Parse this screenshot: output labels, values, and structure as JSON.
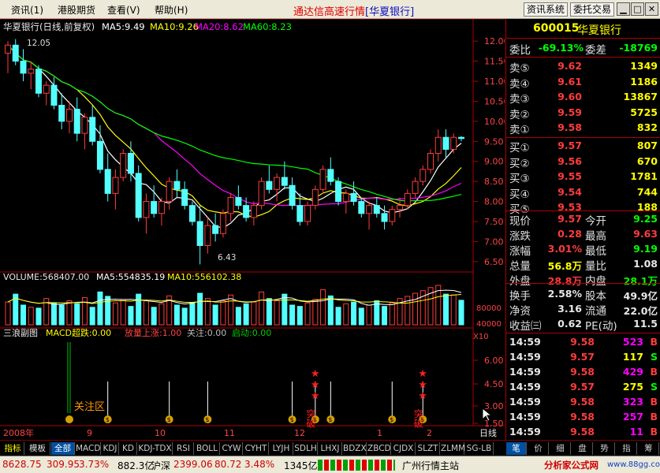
{
  "menu": {
    "items": [
      "资讯(1)",
      "港股期货",
      "查看(V)",
      "帮助(H)"
    ],
    "title": "通达信高速行情",
    "title_stock": "[华夏银行]",
    "btn1": "资讯系统",
    "btn2": "委托交易",
    "win_min": "▁",
    "win_max": "□",
    "win_close": "✕"
  },
  "chart_header": {
    "title": "华夏银行(日线,前复权)",
    "ma5": "MA5:9.49",
    "ma10": "MA10:9.26",
    "ma20": "MA20:8.62",
    "ma60": "MA60:8.23"
  },
  "vol_header": {
    "volume": "VOLUME:568407.00",
    "ma5": "MA5:554835.19",
    "ma10": "MA10:556102.38"
  },
  "ind_header": {
    "name": "三浪副图",
    "v1": "MACD超跌:0.00",
    "v2": "放量上涨:1.00",
    "v3": "关注:0.00",
    "v4": "启动:0.00"
  },
  "annotations": {
    "high": "12.05",
    "low": "6.43",
    "attn_zone": "关注区",
    "buy": "突破"
  },
  "x_axis": {
    "year": "2008年",
    "months": [
      "9",
      "10",
      "11",
      "12",
      "1",
      "2"
    ],
    "period": "日线"
  },
  "price_axis": [
    "12.00",
    "11.50",
    "11.00",
    "10.50",
    "10.00",
    "9.50",
    "9.00",
    "8.50",
    "8.00",
    "7.50",
    "7.00",
    "6.50"
  ],
  "vol_axis": [
    "80000",
    "40000",
    "X10"
  ],
  "ind_axis": [
    "6.00",
    "4.50",
    "3.00",
    "1.50"
  ],
  "chart_data": {
    "type": "candlestick",
    "ylim": [
      6.3,
      12.2
    ],
    "candles": [
      [
        11.7,
        12.0,
        11.2,
        11.9
      ],
      [
        11.9,
        12.05,
        11.4,
        11.5
      ],
      [
        11.5,
        11.8,
        11.0,
        11.2
      ],
      [
        11.2,
        11.5,
        10.8,
        11.3
      ],
      [
        11.3,
        11.4,
        10.6,
        10.7
      ],
      [
        10.7,
        11.0,
        10.4,
        10.9
      ],
      [
        10.9,
        11.1,
        10.3,
        10.4
      ],
      [
        10.4,
        10.7,
        9.8,
        10.0
      ],
      [
        10.0,
        10.5,
        9.7,
        10.3
      ],
      [
        10.3,
        10.6,
        9.5,
        9.7
      ],
      [
        9.7,
        10.2,
        9.3,
        10.1
      ],
      [
        10.1,
        10.4,
        9.4,
        9.5
      ],
      [
        9.5,
        9.9,
        8.7,
        8.8
      ],
      [
        8.8,
        9.2,
        8.0,
        8.2
      ],
      [
        8.2,
        8.8,
        7.8,
        8.6
      ],
      [
        8.6,
        9.3,
        8.5,
        9.2
      ],
      [
        9.2,
        9.5,
        8.5,
        8.7
      ],
      [
        8.7,
        8.9,
        7.5,
        7.6
      ],
      [
        7.6,
        8.2,
        7.2,
        8.0
      ],
      [
        8.0,
        8.4,
        7.6,
        7.7
      ],
      [
        7.7,
        8.1,
        7.4,
        8.0
      ],
      [
        8.0,
        8.6,
        7.8,
        8.5
      ],
      [
        8.5,
        8.8,
        8.1,
        8.3
      ],
      [
        8.3,
        8.5,
        7.8,
        7.9
      ],
      [
        7.9,
        8.0,
        7.4,
        7.5
      ],
      [
        7.5,
        7.9,
        6.43,
        6.9
      ],
      [
        6.9,
        7.6,
        6.7,
        7.4
      ],
      [
        7.4,
        7.7,
        7.0,
        7.2
      ],
      [
        7.2,
        7.8,
        7.1,
        7.7
      ],
      [
        7.7,
        8.2,
        7.5,
        8.1
      ],
      [
        8.1,
        8.4,
        7.8,
        7.9
      ],
      [
        7.9,
        8.1,
        7.5,
        7.6
      ],
      [
        7.6,
        8.0,
        7.4,
        7.9
      ],
      [
        7.9,
        8.6,
        7.8,
        8.5
      ],
      [
        8.5,
        8.9,
        8.2,
        8.3
      ],
      [
        8.3,
        8.7,
        8.0,
        8.6
      ],
      [
        8.6,
        9.0,
        8.3,
        8.4
      ],
      [
        8.4,
        8.6,
        7.8,
        7.9
      ],
      [
        7.9,
        8.2,
        7.4,
        7.5
      ],
      [
        7.5,
        8.0,
        7.4,
        7.9
      ],
      [
        7.9,
        8.4,
        7.8,
        8.3
      ],
      [
        8.3,
        8.9,
        8.2,
        8.8
      ],
      [
        8.8,
        9.1,
        8.4,
        8.5
      ],
      [
        8.5,
        8.6,
        7.9,
        8.0
      ],
      [
        8.0,
        8.3,
        7.7,
        8.2
      ],
      [
        8.2,
        8.5,
        7.9,
        8.0
      ],
      [
        8.0,
        8.1,
        7.6,
        7.7
      ],
      [
        7.7,
        8.0,
        7.3,
        7.9
      ],
      [
        7.9,
        8.1,
        7.6,
        7.7
      ],
      [
        7.7,
        7.9,
        7.3,
        7.5
      ],
      [
        7.5,
        7.9,
        7.4,
        7.8
      ],
      [
        7.8,
        8.1,
        7.6,
        7.9
      ],
      [
        7.9,
        8.3,
        7.8,
        8.2
      ],
      [
        8.2,
        8.6,
        8.1,
        8.5
      ],
      [
        8.5,
        8.9,
        8.4,
        8.8
      ],
      [
        8.8,
        9.3,
        8.7,
        9.2
      ],
      [
        9.2,
        9.8,
        9.0,
        9.6
      ],
      [
        9.6,
        9.8,
        9.1,
        9.3
      ],
      [
        9.3,
        9.7,
        9.2,
        9.6
      ],
      [
        9.6,
        9.63,
        9.5,
        9.57
      ]
    ],
    "volume": [
      52,
      70,
      45,
      40,
      38,
      60,
      50,
      45,
      55,
      48,
      62,
      40,
      75,
      65,
      50,
      58,
      42,
      70,
      55,
      40,
      48,
      66,
      45,
      38,
      50,
      72,
      60,
      45,
      55,
      68,
      40,
      48,
      52,
      75,
      60,
      55,
      70,
      45,
      42,
      50,
      58,
      80,
      66,
      40,
      48,
      52,
      38,
      45,
      55,
      42,
      50,
      60,
      65,
      72,
      78,
      85,
      90,
      70,
      68,
      56
    ],
    "signals": {
      "star_columns": [
        40,
        54
      ],
      "marker_columns": [
        13,
        21,
        26,
        37,
        40,
        42,
        50,
        54
      ]
    }
  },
  "quote": {
    "code": "600015",
    "name": "华夏银行",
    "l_weibi": "委比",
    "weibi": "-69.13%",
    "l_weicha": "委差",
    "weicha": "-18769",
    "sell": [
      {
        "l": "卖⑤",
        "p": "9.62",
        "v": "1349"
      },
      {
        "l": "卖④",
        "p": "9.61",
        "v": "1186"
      },
      {
        "l": "卖③",
        "p": "9.60",
        "v": "13867"
      },
      {
        "l": "卖②",
        "p": "9.59",
        "v": "5725"
      },
      {
        "l": "卖①",
        "p": "9.58",
        "v": "832"
      }
    ],
    "buy": [
      {
        "l": "买①",
        "p": "9.57",
        "v": "807"
      },
      {
        "l": "买②",
        "p": "9.56",
        "v": "670"
      },
      {
        "l": "买③",
        "p": "9.55",
        "v": "1781"
      },
      {
        "l": "买④",
        "p": "9.54",
        "v": "744"
      },
      {
        "l": "买⑤",
        "p": "9.53",
        "v": "188"
      }
    ],
    "l_xianjia": "现价",
    "xianjia": "9.57",
    "l_jinkai": "今开",
    "jinkai": "9.25",
    "l_zhangdie": "涨跌",
    "zhangdie": "0.28",
    "l_zuigao": "最高",
    "zuigao": "9.63",
    "l_zhangfu": "涨幅",
    "zhangfu": "3.01%",
    "l_zuidi": "最低",
    "zuidi": "9.19",
    "l_zongliang": "总量",
    "zongliang": "56.8万",
    "l_liangbi": "量比",
    "liangbi": "1.08",
    "l_waipan": "外盘",
    "waipan": "28.8万",
    "l_neipan": "内盘",
    "neipan": "28.1万",
    "l_huanshou": "换手",
    "huanshou": "2.58%",
    "l_guben": "股本",
    "guben": "49.9亿",
    "l_jingzi": "净资",
    "jingzi": "3.16",
    "l_liutong": "流通",
    "liutong": "22.0亿",
    "l_shouyi": "收益㈢",
    "shouyi": "0.62",
    "l_pe": "PE(动)",
    "pe": "11.5"
  },
  "trades": [
    {
      "t": "14:59",
      "p": "9.58",
      "v": "523",
      "d": "B"
    },
    {
      "t": "14:59",
      "p": "9.57",
      "v": "117",
      "d": "S"
    },
    {
      "t": "14:59",
      "p": "9.58",
      "v": "429",
      "d": "B"
    },
    {
      "t": "14:59",
      "p": "9.57",
      "v": "275",
      "d": "S"
    },
    {
      "t": "14:59",
      "p": "9.58",
      "v": "323",
      "d": "B"
    },
    {
      "t": "14:59",
      "p": "9.58",
      "v": "257",
      "d": "B"
    },
    {
      "t": "14:59",
      "p": "9.58",
      "v": "11",
      "d": "B"
    }
  ],
  "tabs": [
    "指标",
    "模板",
    "全部",
    "MACD",
    "KDJ",
    "KD",
    "KDJ-TDX",
    "RSI",
    "BOLL",
    "CYW",
    "CYHT",
    "LYJH",
    "SDLH",
    "LHXJ",
    "BDZX",
    "ZBCD",
    "CJDX",
    "SLZT",
    "ZLMM",
    "SG-LB"
  ],
  "panel_tabs": [
    "笔",
    "价",
    "细",
    "盘",
    "势",
    "指",
    "筹"
  ],
  "status": {
    "sh": "8628.75",
    "sh_chg": "309.95",
    "sh_pct": "3.73%",
    "sh_amt": "882.3亿",
    "sz_name": "沪深",
    "sz": "2399.06",
    "sz_chg": "80.72",
    "sz_pct": "3.48%",
    "sz_amt": "1345亿",
    "station": "广州行情主站",
    "site": "分析家公式网",
    "site_url": "www.88gg.com"
  },
  "colors": {
    "up": "#ff3c3c",
    "down": "#54ffff",
    "ma5": "#ffffff",
    "ma10": "#ffff00",
    "ma20": "#ff00ff",
    "ma60": "#00ff00",
    "grid": "#b00000"
  }
}
